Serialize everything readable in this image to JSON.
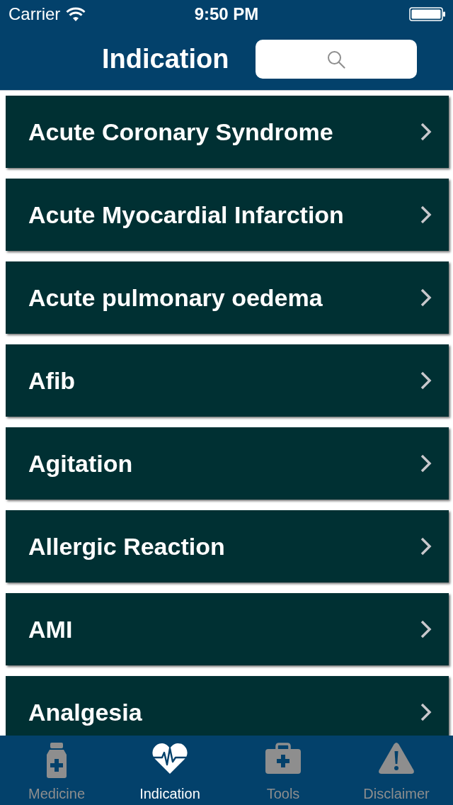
{
  "status_bar": {
    "carrier": "Carrier",
    "time": "9:50 PM"
  },
  "nav_bar": {
    "title": "Indication"
  },
  "indications": [
    {
      "label": "Acute Coronary Syndrome"
    },
    {
      "label": "Acute Myocardial Infarction"
    },
    {
      "label": "Acute pulmonary oedema"
    },
    {
      "label": "Afib"
    },
    {
      "label": "Agitation"
    },
    {
      "label": "Allergic Reaction"
    },
    {
      "label": "AMI"
    },
    {
      "label": "Analgesia"
    }
  ],
  "tab_bar": [
    {
      "label": "Medicine",
      "kind": "medicine",
      "selected": false
    },
    {
      "label": "Indication",
      "kind": "indication",
      "selected": true
    },
    {
      "label": "Tools",
      "kind": "tools",
      "selected": false
    },
    {
      "label": "Disclaimer",
      "kind": "disclaimer",
      "selected": false
    }
  ]
}
